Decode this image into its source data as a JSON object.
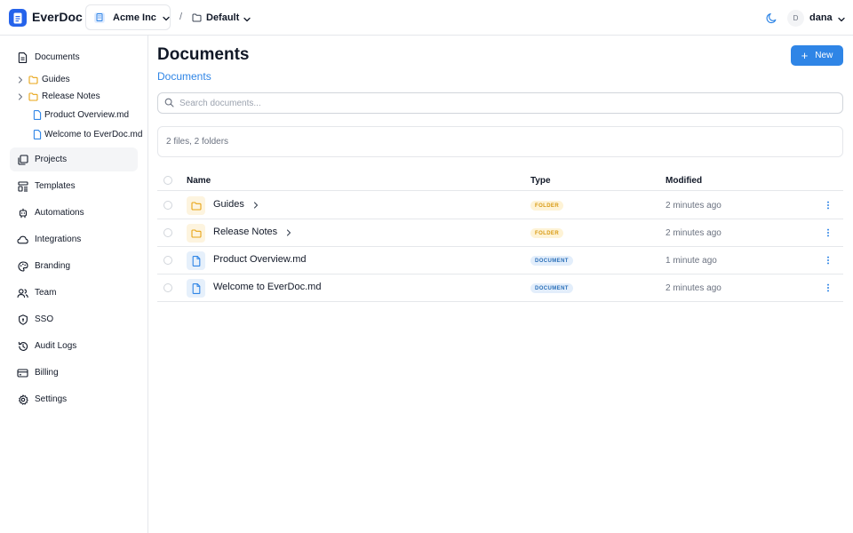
{
  "app": {
    "name": "EverDoc"
  },
  "topbar": {
    "org": "Acme Inc",
    "separator": "/",
    "workspace": "Default",
    "user": {
      "initial": "D",
      "name": "dana"
    },
    "icons": {
      "logo": "document-logo-icon",
      "theme": "moon-icon",
      "chevron": "chevron-down-icon"
    }
  },
  "sidebar": {
    "documents_label": "Documents",
    "tree": [
      {
        "label": "Guides",
        "kind": "folder",
        "expandable": true
      },
      {
        "label": "Release Notes",
        "kind": "folder",
        "expandable": true
      },
      {
        "label": "Product Overview.md",
        "kind": "file",
        "expandable": false
      },
      {
        "label": "Welcome to EverDoc.md",
        "kind": "file",
        "expandable": false
      }
    ],
    "items": [
      {
        "label": "Projects",
        "icon": "projects-icon",
        "active": true
      },
      {
        "label": "Templates",
        "icon": "templates-icon",
        "active": false
      },
      {
        "label": "Automations",
        "icon": "automations-icon",
        "active": false
      },
      {
        "label": "Integrations",
        "icon": "cloud-icon",
        "active": false
      },
      {
        "label": "Branding",
        "icon": "palette-icon",
        "active": false
      },
      {
        "label": "Team",
        "icon": "team-icon",
        "active": false
      },
      {
        "label": "SSO",
        "icon": "shield-icon",
        "active": false
      },
      {
        "label": "Audit Logs",
        "icon": "history-icon",
        "active": false
      },
      {
        "label": "Billing",
        "icon": "credit-card-icon",
        "active": false
      },
      {
        "label": "Settings",
        "icon": "gear-icon",
        "active": false
      }
    ]
  },
  "main": {
    "title": "Documents",
    "new_button": "New",
    "breadcrumb": "Documents",
    "search_placeholder": "Search documents...",
    "summary": "2 files, 2 folders",
    "columns": {
      "name": "Name",
      "type": "Type",
      "modified": "Modified"
    },
    "rows": [
      {
        "name": "Guides",
        "kind": "folder",
        "type": "FOLDER",
        "modified": "2 minutes ago",
        "has_chevron": true
      },
      {
        "name": "Release Notes",
        "kind": "folder",
        "type": "FOLDER",
        "modified": "2 minutes ago",
        "has_chevron": true
      },
      {
        "name": "Product Overview.md",
        "kind": "doc",
        "type": "DOCUMENT",
        "modified": "1 minute ago",
        "has_chevron": false
      },
      {
        "name": "Welcome to EverDoc.md",
        "kind": "doc",
        "type": "DOCUMENT",
        "modified": "2 minutes ago",
        "has_chevron": false
      }
    ]
  },
  "colors": {
    "accent": "#2f85e6",
    "brand": "#2563eb",
    "folder": "#e8a415",
    "folder_badge_bg": "#fef3d6",
    "doc_badge_bg": "#e3eefb",
    "doc_icon": "#2f85e6"
  }
}
